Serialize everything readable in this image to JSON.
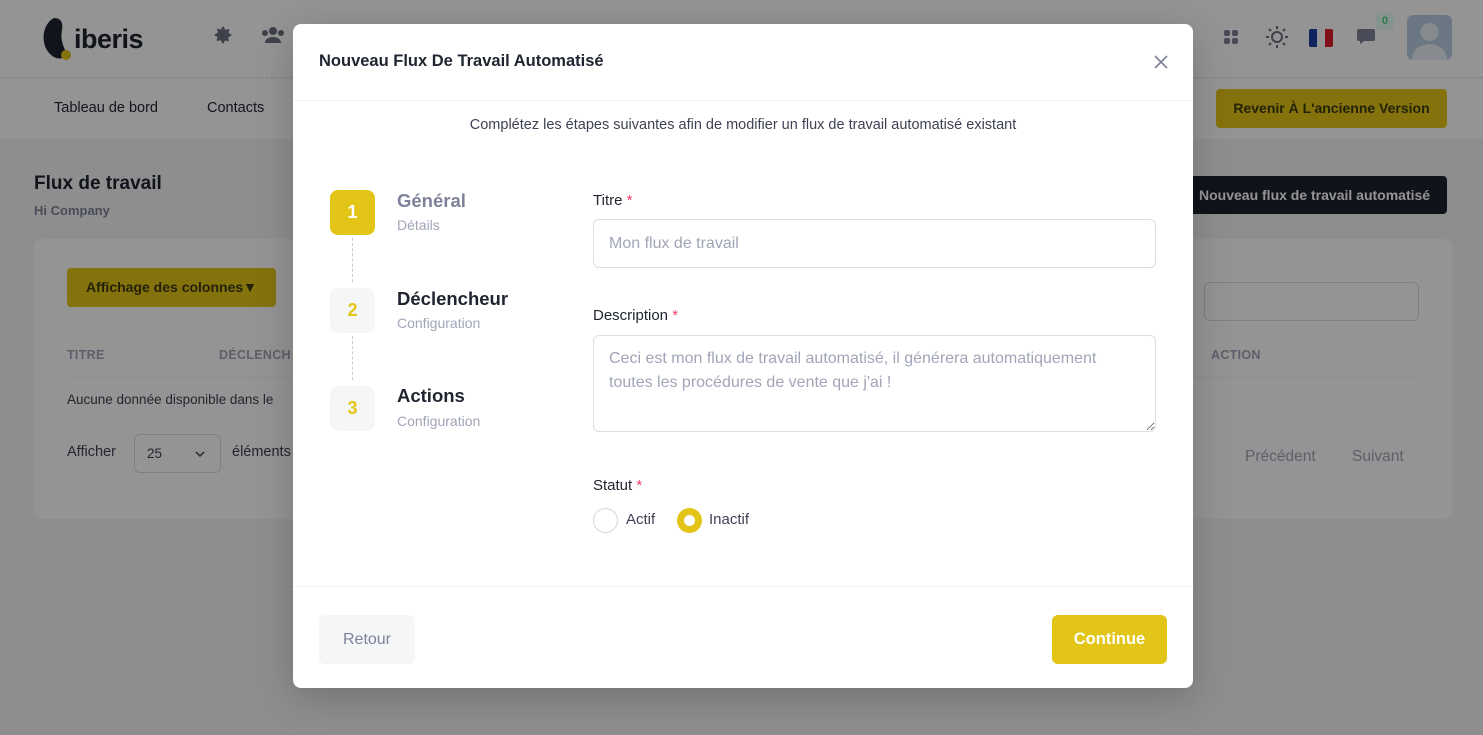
{
  "app": {
    "brand": "iberis",
    "notification_count": "0"
  },
  "navbar": {
    "items": [
      "Tableau de bord",
      "Contacts"
    ],
    "old_version_label": "Revenir À L'ancienne Version"
  },
  "page": {
    "title": "Flux de travail",
    "subtitle": "Hi Company",
    "new_flow_label": "Nouveau flux de travail automatisé",
    "columns_button": "Affichage des colonnes▼",
    "table_headers": [
      "TITRE",
      "DÉCLENCH",
      "ACTION"
    ],
    "no_data": "Aucune donnée disponible dans le",
    "show_label": "Afficher",
    "per_page": "25",
    "elements_label": "éléments",
    "prev_label": "Précédent",
    "next_label": "Suivant"
  },
  "modal": {
    "title": "Nouveau Flux De Travail Automatisé",
    "intro": "Complétez les étapes suivantes afin de modifier un flux de travail automatisé existant",
    "steps": [
      {
        "number": "1",
        "title": "Général",
        "desc": "Détails"
      },
      {
        "number": "2",
        "title": "Déclencheur",
        "desc": "Configuration"
      },
      {
        "number": "3",
        "title": "Actions",
        "desc": "Configuration"
      }
    ],
    "fields": {
      "title_label": "Titre",
      "title_placeholder": "Mon flux de travail",
      "title_value": "",
      "description_label": "Description",
      "description_placeholder": "Ceci est mon flux de travail automatisé, il générera automatiquement toutes les procédures de vente que j'ai !",
      "description_value": "",
      "status_label": "Statut",
      "status_options": [
        "Actif",
        "Inactif"
      ],
      "status_selected": "Inactif",
      "required_mark": "*"
    },
    "footer": {
      "back_label": "Retour",
      "continue_label": "Continue"
    }
  },
  "colors": {
    "accent": "#e3c517",
    "dark": "#1e2130",
    "required": "#f1416c"
  }
}
